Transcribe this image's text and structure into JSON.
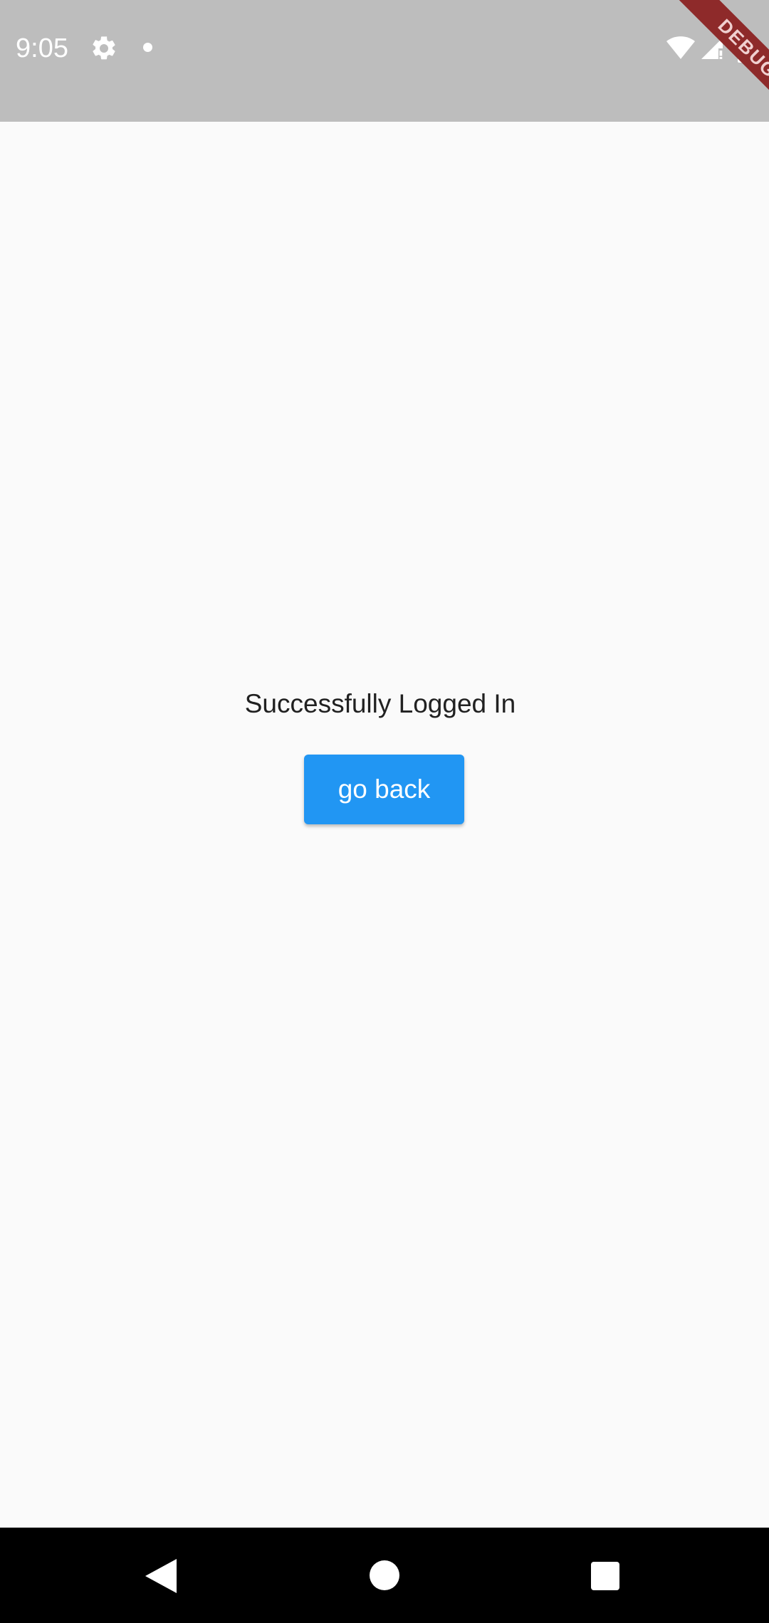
{
  "status_bar": {
    "time": "9:05",
    "background": "#bdbdbd",
    "icons": [
      "gear-icon",
      "notification-dot-icon",
      "wifi-icon",
      "signal-icon",
      "battery-icon"
    ]
  },
  "debug_banner": {
    "label": "DEBUG",
    "color": "#8e2a2a"
  },
  "main": {
    "message": "Successfully Logged In",
    "go_back_label": "go back",
    "button_color": "#2196f3"
  },
  "nav_bar": {
    "icons": [
      "back-icon",
      "home-icon",
      "recents-icon"
    ]
  }
}
